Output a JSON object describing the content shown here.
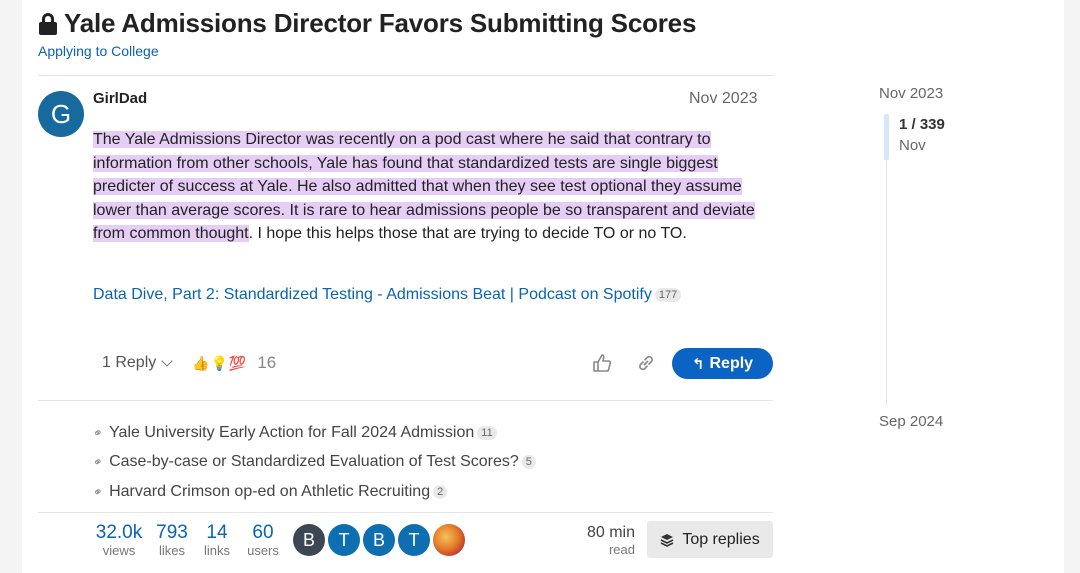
{
  "topic": {
    "title": "Yale Admissions Director Favors Submitting Scores",
    "category": "Applying to College"
  },
  "post": {
    "avatar_letter": "G",
    "username": "GirlDad",
    "date": "Nov 2023",
    "highlighted_text": "The Yale Admissions Director was recently on a pod cast where he said that contrary to information from other schools, Yale has found that standardized tests are single biggest predicter of success at Yale. He also admitted that when they see test optional they assume lower than average scores. It is rare to hear admissions people be so transparent and deviate from common thought",
    "plain_text": ". I hope this helps those that are trying to decide TO or no TO.",
    "link_text": "Data Dive, Part 2: Standardized Testing - Admissions Beat | Podcast on Spotify",
    "link_clicks": "177",
    "replies_label": "1 Reply",
    "reactions": [
      "👍",
      "💡",
      "💯"
    ],
    "reaction_count": "16",
    "reply_button": "Reply"
  },
  "related_links": [
    {
      "title": "Yale University Early Action for Fall 2024 Admission",
      "count": "11"
    },
    {
      "title": "Case-by-case or Standardized Evaluation of Test Scores?",
      "count": "5"
    },
    {
      "title": "Harvard Crimson op-ed on Athletic Recruiting",
      "count": "2"
    }
  ],
  "stats": {
    "views": {
      "num": "32.0k",
      "label": "views"
    },
    "likes": {
      "num": "793",
      "label": "likes"
    },
    "links": {
      "num": "14",
      "label": "links"
    },
    "users": {
      "num": "60",
      "label": "users"
    }
  },
  "participants": [
    {
      "letter": "B",
      "color": "#3d4753"
    },
    {
      "letter": "T",
      "color": "#0e6fb0"
    },
    {
      "letter": "B",
      "color": "#0e6fb0"
    },
    {
      "letter": "T",
      "color": "#0e6fb0"
    }
  ],
  "read_time": {
    "num": "80 min",
    "label": "read"
  },
  "top_replies_label": "Top replies",
  "timeline": {
    "start": "Nov 2023",
    "position": "1 / 339",
    "position_date": "Nov",
    "end": "Sep 2024"
  }
}
